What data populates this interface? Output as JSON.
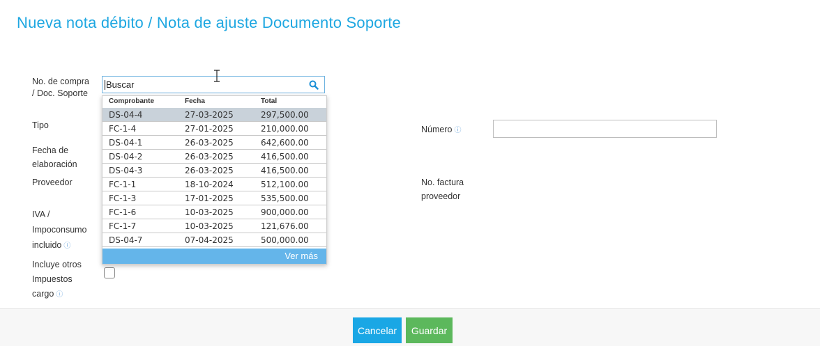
{
  "page": {
    "title": "Nueva nota débito / Nota de ajuste Documento Soporte"
  },
  "form": {
    "labels": {
      "purchase_line1": "No. de compra",
      "purchase_line2": "/ Doc. Soporte",
      "tipo": "Tipo",
      "fecha_line1": "Fecha de",
      "fecha_line2": "elaboración",
      "proveedor": "Proveedor",
      "iva_line1": "IVA /",
      "iva_line2": "Impoconsumo",
      "iva_line3": "incluido",
      "otros_line1": "Incluye otros",
      "otros_line2": "Impuestos",
      "otros_line3": "cargo",
      "numero": "Número",
      "factura_line1": "No. factura",
      "factura_line2": "proveedor"
    },
    "info_glyph": "ⓘ",
    "search": {
      "value": "Buscar",
      "icon": "search-icon"
    },
    "numero_value": ""
  },
  "dropdown": {
    "headers": [
      "Comprobante",
      "Fecha",
      "Total"
    ],
    "rows": [
      [
        "DS-04-4",
        "27-03-2025",
        "297,500.00"
      ],
      [
        "FC-1-4",
        "27-01-2025",
        "210,000.00"
      ],
      [
        "DS-04-1",
        "26-03-2025",
        "642,600.00"
      ],
      [
        "DS-04-2",
        "26-03-2025",
        "416,500.00"
      ],
      [
        "DS-04-3",
        "26-03-2025",
        "416,500.00"
      ],
      [
        "FC-1-1",
        "18-10-2024",
        "512,100.00"
      ],
      [
        "FC-1-3",
        "17-01-2025",
        "535,500.00"
      ],
      [
        "FC-1-6",
        "10-03-2025",
        "900,000.00"
      ],
      [
        "FC-1-7",
        "10-03-2025",
        "121,676.00"
      ],
      [
        "DS-04-7",
        "07-04-2025",
        "500,000.00"
      ]
    ],
    "more_label": "Ver más"
  },
  "footer": {
    "cancel_label": "Cancelar",
    "save_label": "Guardar"
  },
  "colors": {
    "accent": "#1ea7e1",
    "save": "#5cb85c",
    "more_bar": "#64b5ea"
  }
}
